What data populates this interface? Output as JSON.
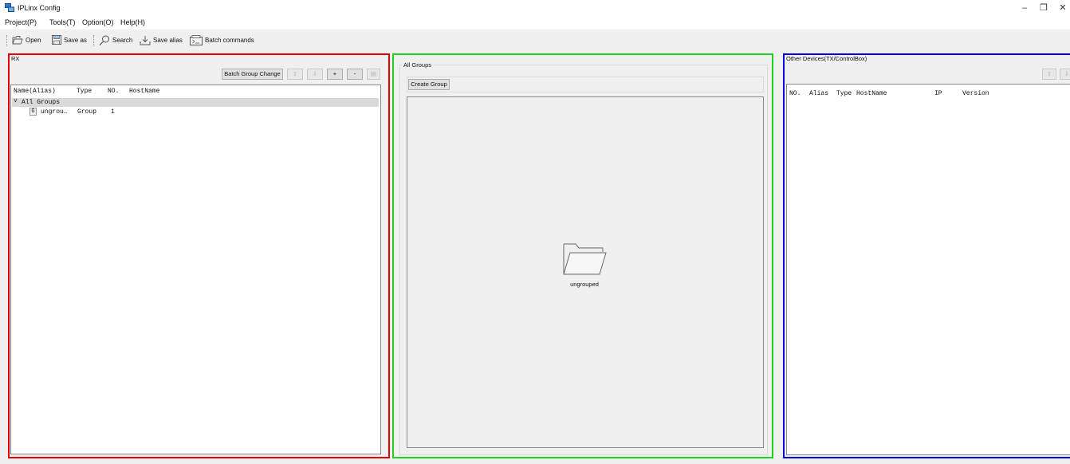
{
  "window": {
    "title": "IPLinx Config",
    "minimize": "–",
    "maximize": "❐",
    "close": "✕"
  },
  "menu": [
    "Project(P)",
    "Tools(T)",
    "Option(O)",
    "Help(H)"
  ],
  "toolbar": {
    "open": "Open",
    "save_as": "Save as",
    "search": "Search",
    "save_alias": "Save alias",
    "batch_commands": "Batch commands"
  },
  "rx_panel": {
    "title": "RX",
    "batch_group_change": "Batch Group Change",
    "up_label": "⇧",
    "down_label": "⇩",
    "plus": "+",
    "minus": "-",
    "edit_label": "▤",
    "columns": [
      "Name(Alias)",
      "Type",
      "NO.",
      "HostName"
    ],
    "root_row": {
      "expander": "˅",
      "name": "All Groups"
    },
    "rows": [
      {
        "badge": "G",
        "name": "ungrou…",
        "type": "Group",
        "no": "1",
        "hostname": ""
      }
    ]
  },
  "groups_panel": {
    "title": "All Groups",
    "create_group": "Create Group",
    "folders": [
      {
        "label": "ungrouped",
        "icon": "folder-icon"
      }
    ]
  },
  "other_panel": {
    "title": "Other Devices(TX/ControlBox)",
    "up_label": "⇧",
    "down_label": "⇩",
    "columns": [
      "NO.",
      "Alias",
      "Type",
      "HostName",
      "IP",
      "Version"
    ]
  },
  "colors": {
    "rx_border": "#e60000",
    "groups_border": "#1ed11e",
    "other_border": "#0000e6"
  }
}
